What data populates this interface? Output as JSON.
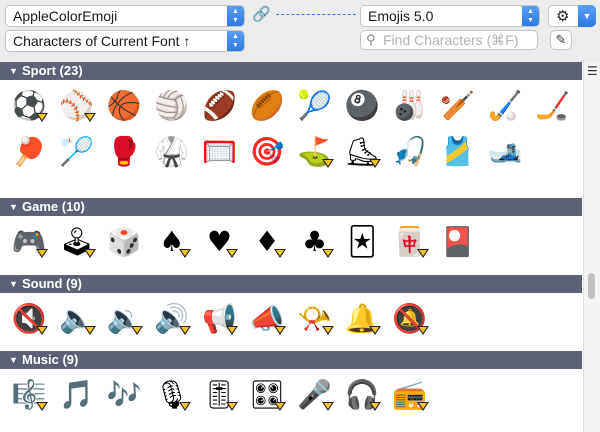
{
  "toolbar": {
    "font_select": "AppleColorEmoji",
    "version_select": "Emojis 5.0",
    "filter_select": "Characters of Current Font ↑",
    "search_placeholder": "Find Characters (⌘F)",
    "link_icon": "link-icon",
    "gear_icon": "gear-icon",
    "pencil_icon": "pencil-icon",
    "accent": "#2a78e4"
  },
  "sections": [
    {
      "label": "Sport (23)",
      "cells": [
        {
          "char": "⚽",
          "tag": true
        },
        {
          "char": "⚾",
          "tag": true
        },
        {
          "char": "🏀",
          "tag": false
        },
        {
          "char": "🏐",
          "tag": false
        },
        {
          "char": "🏈",
          "tag": false
        },
        {
          "char": "🏉",
          "tag": false
        },
        {
          "char": "🎾",
          "tag": false
        },
        {
          "char": "🎱",
          "tag": false
        },
        {
          "char": "🎳",
          "tag": false
        },
        {
          "char": "🏏",
          "tag": false
        },
        {
          "char": "🏑",
          "tag": false
        },
        {
          "char": "🏒",
          "tag": false
        },
        {
          "char": "🏓",
          "tag": false
        },
        {
          "char": "🏸",
          "tag": false
        },
        {
          "char": "🥊",
          "tag": false
        },
        {
          "char": "🥋",
          "tag": false
        },
        {
          "char": "🥅",
          "tag": false
        },
        {
          "char": "🎯",
          "tag": false
        },
        {
          "char": "⛳",
          "tag": true
        },
        {
          "char": "⛸",
          "tag": true
        },
        {
          "char": "🎣",
          "tag": false
        },
        {
          "char": "🎽",
          "tag": false
        },
        {
          "char": "🎿",
          "tag": false
        }
      ]
    },
    {
      "label": "Game (10)",
      "cells": [
        {
          "char": "🎮",
          "tag": true
        },
        {
          "char": "🕹",
          "tag": true
        },
        {
          "char": "🎲",
          "tag": false
        },
        {
          "char": "♠",
          "tag": true
        },
        {
          "char": "♥",
          "tag": true
        },
        {
          "char": "♦",
          "tag": true
        },
        {
          "char": "♣",
          "tag": true
        },
        {
          "char": "🃏",
          "tag": false
        },
        {
          "char": "🀄",
          "tag": true
        },
        {
          "char": "🎴",
          "tag": false
        }
      ]
    },
    {
      "label": "Sound (9)",
      "cells": [
        {
          "char": "🔇",
          "tag": true
        },
        {
          "char": "🔈",
          "tag": true
        },
        {
          "char": "🔉",
          "tag": true
        },
        {
          "char": "🔊",
          "tag": true
        },
        {
          "char": "📢",
          "tag": true
        },
        {
          "char": "📣",
          "tag": true
        },
        {
          "char": "📯",
          "tag": true
        },
        {
          "char": "🔔",
          "tag": true
        },
        {
          "char": "🔕",
          "tag": true
        }
      ]
    },
    {
      "label": "Music (9)",
      "cells": [
        {
          "char": "🎼",
          "tag": true
        },
        {
          "char": "🎵",
          "tag": false
        },
        {
          "char": "🎶",
          "tag": false
        },
        {
          "char": "🎙",
          "tag": true
        },
        {
          "char": "🎚",
          "tag": true
        },
        {
          "char": "🎛",
          "tag": true
        },
        {
          "char": "🎤",
          "tag": true
        },
        {
          "char": "🎧",
          "tag": true
        },
        {
          "char": "📻",
          "tag": true
        }
      ]
    }
  ]
}
